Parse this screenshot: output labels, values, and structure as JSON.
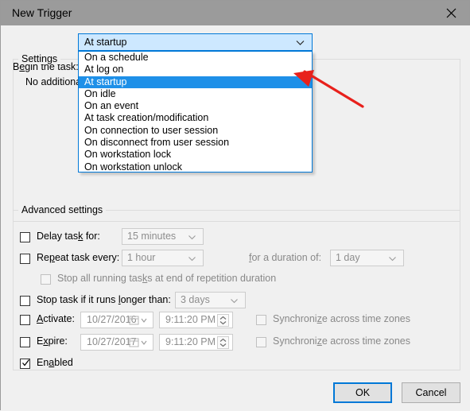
{
  "window": {
    "title": "New Trigger",
    "close_icon": "close-icon"
  },
  "begin_task": {
    "label_pre": "B",
    "label_acc": "e",
    "label_post": "gin the task:",
    "label_full": "Begin the task:",
    "selected": "At startup",
    "expanded": true,
    "options": [
      "On a schedule",
      "At log on",
      "At startup",
      "On idle",
      "On an event",
      "At task creation/modification",
      "On connection to user session",
      "On disconnect from user session",
      "On workstation lock",
      "On workstation unlock"
    ],
    "selected_index": 2,
    "chevron_icon": "chevron-down-icon"
  },
  "settings_group": {
    "title": "Settings",
    "note": "No additional"
  },
  "advanced_group": {
    "title": "Advanced settings",
    "delay": {
      "label_full": "Delay task for:",
      "checked": false,
      "value": "15 minutes",
      "enabled": false
    },
    "repeat": {
      "label_full": "Repeat task every:",
      "checked": false,
      "value": "1 hour",
      "enabled": false,
      "duration_label": "for a duration of:",
      "duration_value": "1 day"
    },
    "stop_all": {
      "label_full": "Stop all running tasks at end of repetition duration",
      "checked": false,
      "enabled": false
    },
    "stop_longer": {
      "label_full": "Stop task if it runs longer than:",
      "checked": false,
      "value": "3 days",
      "enabled": false
    },
    "activate": {
      "label_full": "Activate:",
      "checked": false,
      "date": "10/27/2016",
      "time": "9:11:20 PM",
      "sync_label": "Synchronize across time zones",
      "sync_checked": false
    },
    "expire": {
      "label_full": "Expire:",
      "checked": false,
      "date": "10/27/2017",
      "time": "9:11:20 PM",
      "sync_label": "Synchronize across time zones",
      "sync_checked": false
    },
    "enabled": {
      "label_full": "Enabled",
      "checked": true
    }
  },
  "buttons": {
    "ok": "OK",
    "cancel": "Cancel"
  },
  "annotation": {
    "arrow_color": "#e8211c",
    "points_to": "At startup"
  },
  "colors": {
    "titlebar": "#9b9b9b",
    "dialog_bg": "#f0f0f0",
    "accent": "#0078d7",
    "selection": "#1e90e8",
    "combo_fill": "#cde8ff",
    "disabled_text": "#8d8d8d"
  }
}
